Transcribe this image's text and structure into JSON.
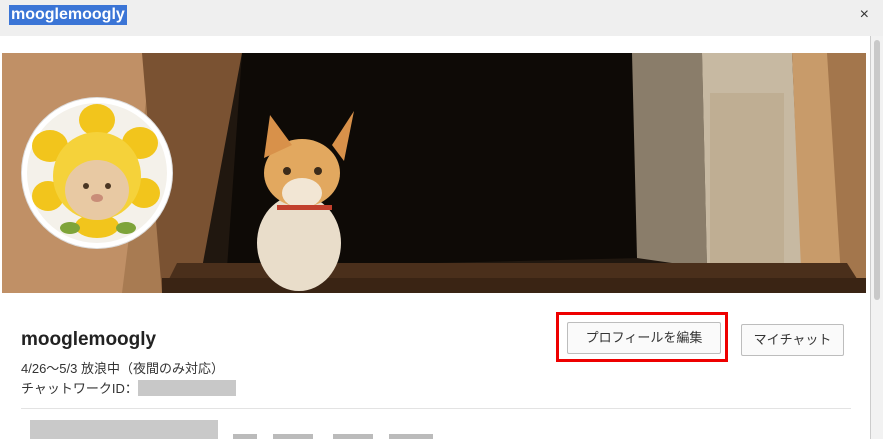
{
  "window": {
    "title": "mooglemoogly",
    "close_glyph": "×"
  },
  "profile": {
    "name": "mooglemoogly",
    "status": "4/26～5/3 放浪中（夜間のみ対応）",
    "chatwork_id_label": "チャットワークID：",
    "chatwork_id_value": ""
  },
  "buttons": {
    "edit_profile": "プロフィールを編集",
    "my_chat": "マイチャット"
  },
  "images": {
    "cover": "cat-in-window-photo",
    "avatar": "cat-in-flower-hat-photo"
  },
  "colors": {
    "highlight": "#ee0000",
    "title_selection": "#3b75d6"
  }
}
